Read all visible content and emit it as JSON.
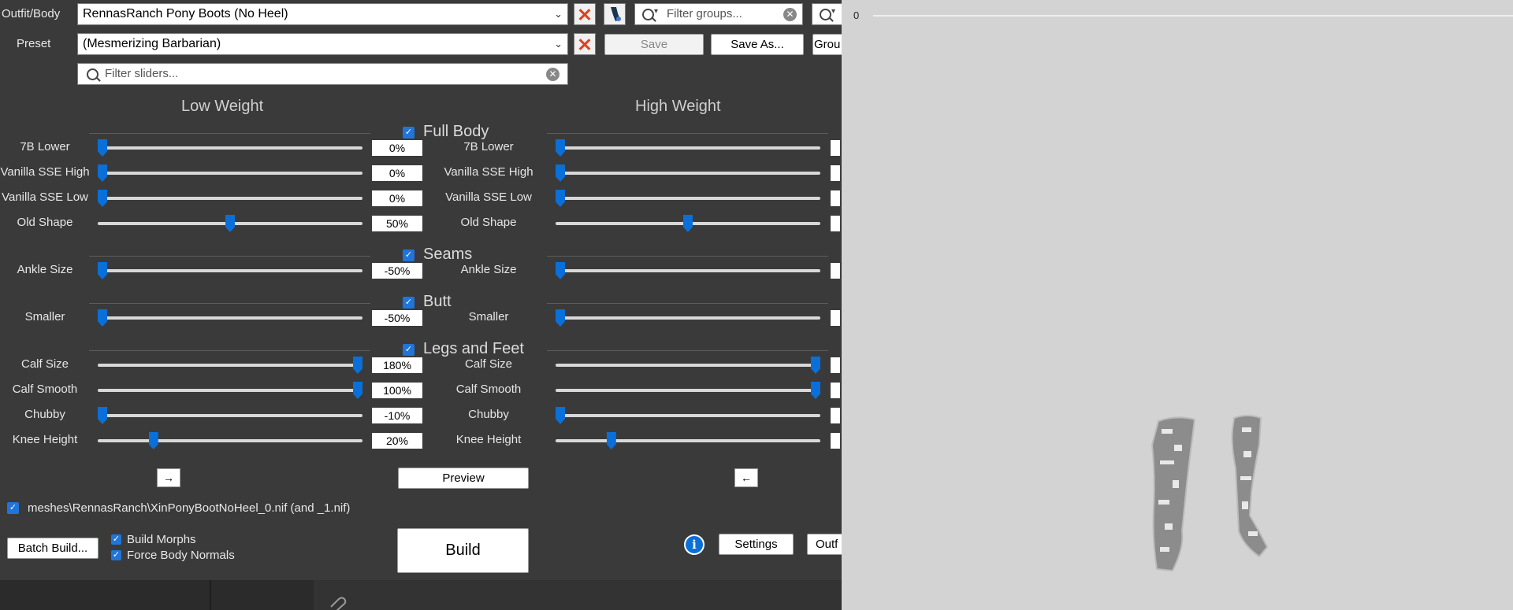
{
  "top": {
    "outfit_label": "Outfit/Body",
    "outfit_value": "RennasRanch Pony Boots (No Heel)",
    "preset_label": "Preset",
    "preset_value": "(Mesmerizing Barbarian)",
    "filter_groups_placeholder": "Filter groups...",
    "filter_sliders_placeholder": "Filter sliders...",
    "save_label": "Save",
    "save_as_label": "Save As...",
    "groups_partial_label": "Grou"
  },
  "columns": {
    "low_title": "Low Weight",
    "high_title": "High Weight"
  },
  "categories": [
    {
      "name": "Full Body",
      "checked": true,
      "sliders": [
        {
          "name": "7B Lower",
          "low": "0%",
          "low_pos": 0.0,
          "high_pos": 0.0
        },
        {
          "name": "Vanilla SSE High",
          "low": "0%",
          "low_pos": 0.0,
          "high_pos": 0.0
        },
        {
          "name": "Vanilla SSE Low",
          "low": "0%",
          "low_pos": 0.0,
          "high_pos": 0.0
        },
        {
          "name": "Old Shape",
          "low": "50%",
          "low_pos": 0.5,
          "high_pos": 0.5
        }
      ]
    },
    {
      "name": "Seams",
      "checked": true,
      "sliders": [
        {
          "name": "Ankle Size",
          "low": "-50%",
          "low_pos": 0.0,
          "high_pos": 0.0
        }
      ]
    },
    {
      "name": "Butt",
      "checked": true,
      "sliders": [
        {
          "name": "Smaller",
          "low": "-50%",
          "low_pos": 0.0,
          "high_pos": 0.0
        }
      ]
    },
    {
      "name": "Legs and Feet",
      "checked": true,
      "sliders": [
        {
          "name": "Calf Size",
          "low": "180%",
          "low_pos": 1.0,
          "high_pos": 1.0
        },
        {
          "name": "Calf Smooth",
          "low": "100%",
          "low_pos": 1.0,
          "high_pos": 1.0
        },
        {
          "name": "Chubby",
          "low": "-10%",
          "low_pos": 0.0,
          "high_pos": 0.0
        },
        {
          "name": "Knee Height",
          "low": "20%",
          "low_pos": 0.2,
          "high_pos": 0.2
        }
      ]
    }
  ],
  "footer": {
    "arrow_right": "→",
    "preview_label": "Preview",
    "arrow_left": "←",
    "output_path": "meshes\\RennasRanch\\XinPonyBootNoHeel_0.nif (and _1.nif)",
    "batch_build_label": "Batch Build...",
    "build_morphs_label": "Build Morphs",
    "force_normals_label": "Force Body Normals",
    "build_label": "Build",
    "settings_label": "Settings",
    "outfit_partial_label": "Outf"
  },
  "viewport": {
    "axis_zero": "0"
  },
  "colors": {
    "panel_bg": "#3a3a3a",
    "accent": "#1f75d9",
    "close_red": "#e0401c",
    "viewport_bg": "#d3d3d3"
  }
}
